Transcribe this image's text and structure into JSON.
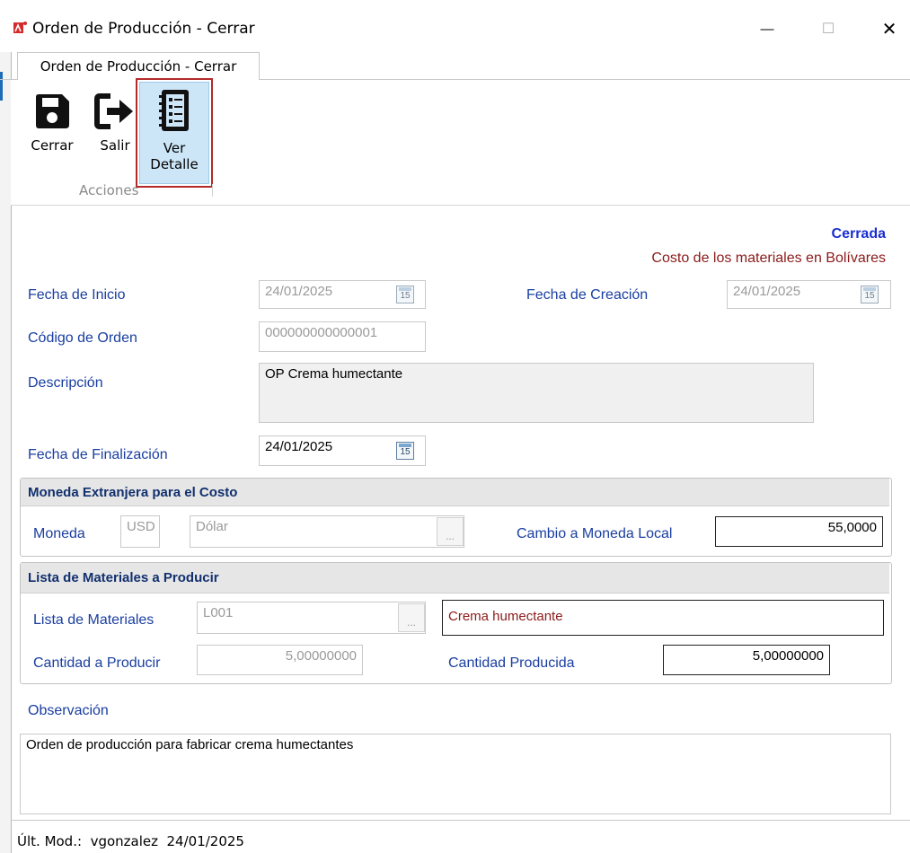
{
  "window": {
    "title": "Orden de Producción - Cerrar",
    "minimize_glyph": "—",
    "maximize_glyph": "☐",
    "close_glyph": "✕"
  },
  "tab": {
    "label": "Orden de Producción - Cerrar"
  },
  "ribbon": {
    "buttons": [
      {
        "label": "Cerrar",
        "icon": "save-icon"
      },
      {
        "label": "Salir",
        "icon": "exit-icon"
      },
      {
        "label_line1": "Ver",
        "label_line2": "Detalle",
        "icon": "notebook-icon",
        "selected": true
      }
    ],
    "group_label": "Acciones"
  },
  "status": {
    "state": "Cerrada",
    "cost_note": "Costo de los materiales en Bolívares"
  },
  "form": {
    "fecha_inicio": {
      "label": "Fecha de Inicio",
      "value": "24/01/2025",
      "cal_day": "15"
    },
    "fecha_creacion": {
      "label": "Fecha de Creación",
      "value": "24/01/2025",
      "cal_day": "15"
    },
    "codigo_orden": {
      "label": "Código de Orden",
      "value": "000000000000001"
    },
    "descripcion": {
      "label": "Descripción",
      "value": "OP Crema humectante"
    },
    "fecha_finalizacion": {
      "label": "Fecha de Finalización",
      "value": "24/01/2025",
      "cal_day": "15"
    }
  },
  "moneda_group": {
    "title": "Moneda Extranjera para el Costo",
    "moneda_label": "Moneda",
    "moneda_code": "USD",
    "moneda_name": "Dólar",
    "lookup": "...",
    "cambio_label": "Cambio a Moneda Local",
    "cambio_value": "55,0000"
  },
  "lista_group": {
    "title": "Lista de Materiales a Producir",
    "lista_label": "Lista de Materiales",
    "lista_code": "L001",
    "lookup": "...",
    "lista_name": "Crema humectante",
    "cantidad_label": "Cantidad a Producir",
    "cantidad_value": "5,00000000",
    "producida_label": "Cantidad Producida",
    "producida_value": "5,00000000"
  },
  "observacion": {
    "label": "Observación",
    "value": "Orden de producción para fabricar crema humectantes"
  },
  "footer": {
    "last_mod": "Últ. Mod.:  vgonzalez  24/01/2025"
  },
  "colors": {
    "label_blue": "#1a3ea0",
    "status_blue": "#1a2fd0",
    "note_red": "#8b1a1a",
    "selection_red": "#b22a2a"
  }
}
